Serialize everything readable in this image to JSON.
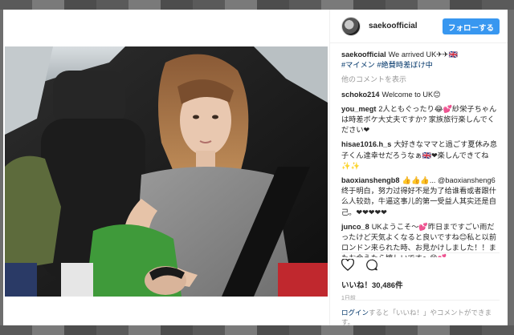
{
  "header": {
    "username": "saekoofficial",
    "follow_label": "フォローする"
  },
  "caption": {
    "username": "saekoofficial",
    "text": "We arrived UK✈✈🇬🇧",
    "hashtags": "#マイメン #絶賛時差ぼけ中"
  },
  "more_comments_label": "他のコメントを表示",
  "comments": [
    {
      "username": "schoko214",
      "text": "Welcome to UK😊"
    },
    {
      "username": "you_megt",
      "text": "2人ともぐったり😂💕紗栄子ちゃんは時差ボケ大丈夫ですか? 家族旅行楽しんでください❤"
    },
    {
      "username": "hisae1016.h_s",
      "text": "大好きなママと過ごす夏休み息子くん達幸せだろうなぁ🇬🇧❤楽しんできてね✨✨"
    },
    {
      "username": "baoxianshengb8",
      "text": "👍👍👍... @baoxiansheng6 终于明白，努力过得好不是为了给谁看或者跟什么人较劲，牛逼这事儿的第一受益人其实还是自己。❤❤❤❤❤"
    },
    {
      "username": "junco_8",
      "text": "UKようこそ〜💕昨日まですごい雨だったけど天気よくなると良いですね😊私と以前ロンドン来られた時、お見かけしました！！またお会えたら嬉しいです〜😊💕"
    }
  ],
  "likes": {
    "label_prefix": "いいね！",
    "count": "30,486件"
  },
  "timestamp": "1日前",
  "login_bar": {
    "link": "ログイン",
    "text": "すると「いいね！」やコメントができます。"
  },
  "colors": {
    "follow_button": "#3897f0",
    "link": "#003569",
    "muted": "#999999"
  }
}
